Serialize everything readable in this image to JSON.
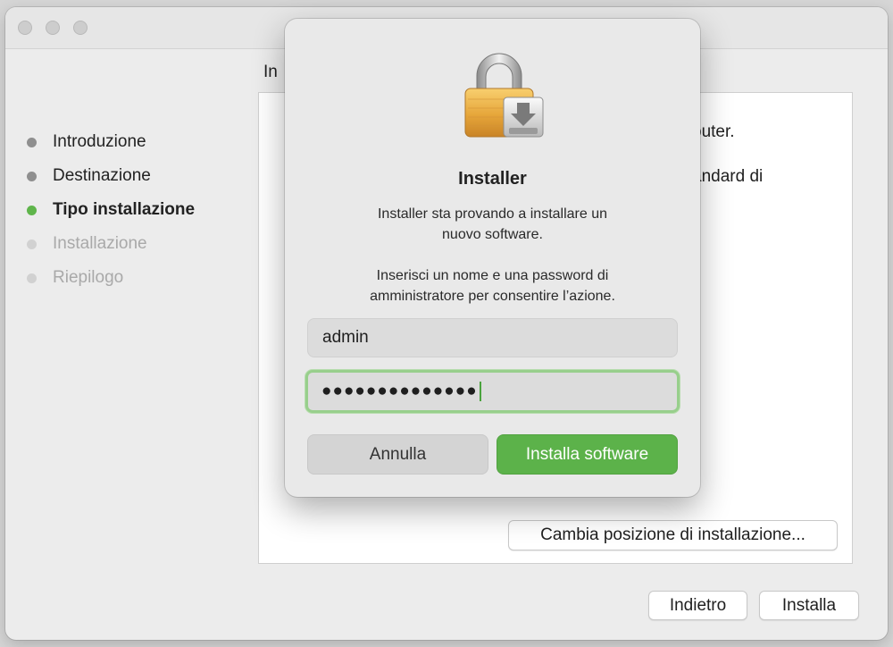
{
  "window": {
    "heading": "In"
  },
  "steps": [
    {
      "label": "Introduzione",
      "state": "done"
    },
    {
      "label": "Destinazione",
      "state": "done"
    },
    {
      "label": "Tipo installazione",
      "state": "current"
    },
    {
      "label": "Installazione",
      "state": "future"
    },
    {
      "label": "Riepilogo",
      "state": "future"
    }
  ],
  "content": {
    "line1": "outer.",
    "line2": "andard di",
    "change_location_button": "Cambia posizione di installazione..."
  },
  "footer": {
    "back_button": "Indietro",
    "install_button": "Installa"
  },
  "dialog": {
    "title": "Installer",
    "message1": "Installer sta provando a installare un\nnuovo software.",
    "message2": "Inserisci un nome e una password di\namministratore per consentire l’azione.",
    "username_value": "admin",
    "password_value": "●●●●●●●●●●●●●●",
    "cancel_button": "Annulla",
    "confirm_button": "Installa software",
    "icon": "lock-installer-icon"
  },
  "colors": {
    "accent": "#5cb24a",
    "current_step": "#5fb54b",
    "focus_ring": "#98cf8c"
  }
}
